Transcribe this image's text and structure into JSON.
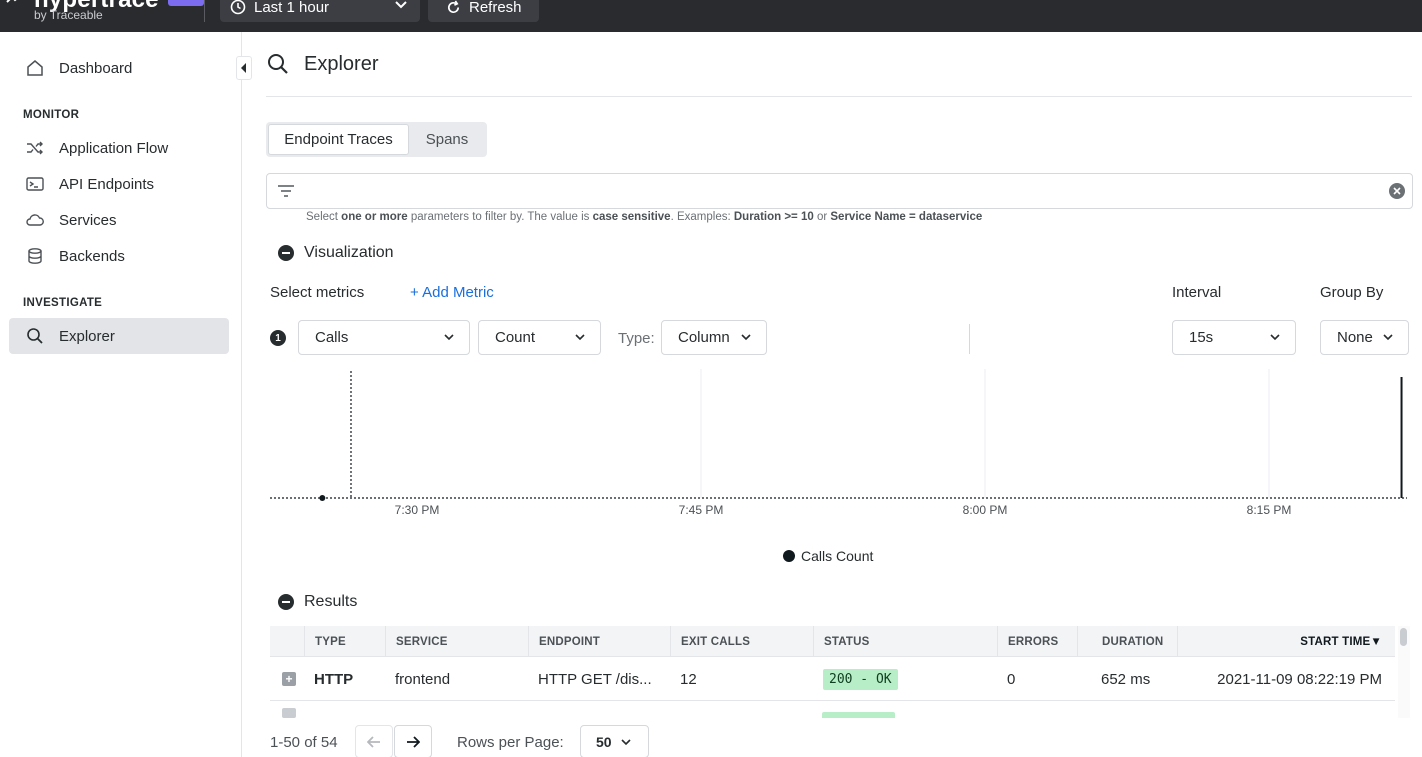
{
  "topbar": {
    "brand_name": "hypertrace",
    "brand_sub": "by Traceable",
    "time_range": "Last 1 hour",
    "refresh_label": "Refresh"
  },
  "sidebar": {
    "dashboard": "Dashboard",
    "monitor_section": "MONITOR",
    "monitor_items": [
      "Application Flow",
      "API Endpoints",
      "Services",
      "Backends"
    ],
    "investigate_section": "INVESTIGATE",
    "explorer": "Explorer"
  },
  "page": {
    "title": "Explorer"
  },
  "tabs": {
    "endpoint_traces": "Endpoint Traces",
    "spans": "Spans",
    "active": "Endpoint Traces"
  },
  "filter": {
    "value": "",
    "hint_parts": [
      "Select ",
      "one or more",
      " parameters to filter by. The value is ",
      "case sensitive",
      ". Examples: ",
      "Duration >= 10",
      " or ",
      "Service Name = dataservice"
    ]
  },
  "visualization": {
    "title": "Visualization",
    "select_metrics": "Select metrics",
    "add_metric": "+ Add Metric",
    "interval_label": "Interval",
    "group_by_label": "Group By",
    "row_number": "1",
    "metric": "Calls",
    "aggregation": "Count",
    "type_label": "Type:",
    "type_value": "Column",
    "interval_value": "15s",
    "group_by_value": "None",
    "legend": "Calls Count"
  },
  "chart_data": {
    "type": "bar",
    "series": [
      {
        "name": "Calls Count",
        "points": [
          {
            "x": "7:25 PM",
            "y": 0
          },
          {
            "x": "8:22 PM",
            "y": 1
          }
        ]
      }
    ],
    "x_ticks": [
      "7:30 PM",
      "7:45 PM",
      "8:00 PM",
      "8:15 PM"
    ],
    "ylim": [
      0,
      1
    ],
    "grid": true,
    "legend_position": "bottom"
  },
  "results": {
    "title": "Results",
    "columns": [
      "TYPE",
      "SERVICE",
      "ENDPOINT",
      "EXIT CALLS",
      "STATUS",
      "ERRORS",
      "DURATION",
      "START TIME▼"
    ],
    "rows": [
      {
        "type": "HTTP",
        "service": "frontend",
        "endpoint": "HTTP GET /dis...",
        "exit_calls": "12",
        "status": "200 - OK",
        "errors": "0",
        "duration": "652 ms",
        "start_time": "2021-11-09 08:22:19 PM"
      }
    ]
  },
  "pagination": {
    "range": "1-50 of 54",
    "rows_per_page_label": "Rows per Page:",
    "rows_per_page": "50"
  },
  "colors": {
    "topbar": "#2a2b2f",
    "accent_link": "#1a6fdb",
    "status_ok_bg": "#b7eec7",
    "brand_badge": "#7c6cf0"
  }
}
